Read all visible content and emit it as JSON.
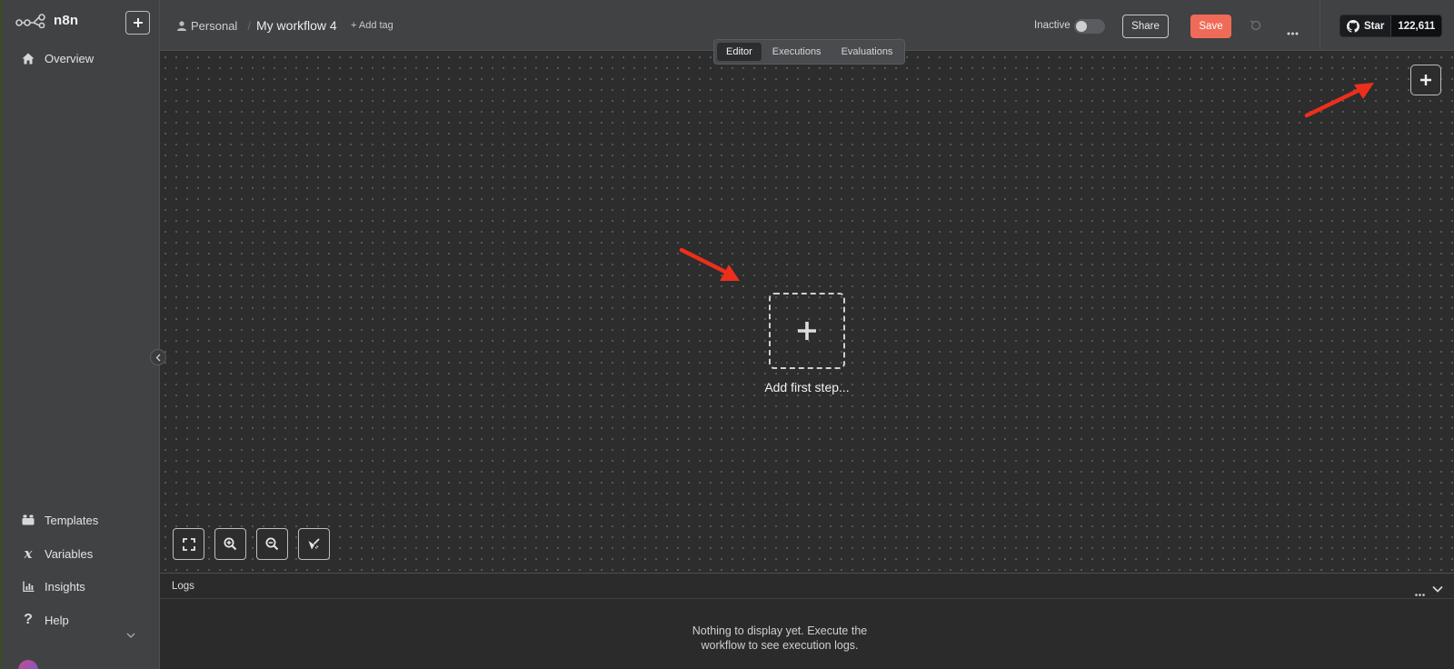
{
  "app": {
    "logo_text": "n8n",
    "accent_color": "#ef6b58"
  },
  "sidebar": {
    "top_items": [
      {
        "label": "Overview",
        "icon": "home-icon"
      }
    ],
    "bottom_items": [
      {
        "label": "Templates",
        "icon": "templates-icon"
      },
      {
        "label": "Variables",
        "icon": "variables-icon"
      },
      {
        "label": "Insights",
        "icon": "insights-icon"
      },
      {
        "label": "Help",
        "icon": "help-icon"
      }
    ]
  },
  "header": {
    "project": "Personal",
    "separator": "/",
    "workflow_name": "My workflow 4",
    "add_tag": "+ Add tag",
    "status_label": "Inactive",
    "share_label": "Share",
    "save_label": "Save",
    "github": {
      "star_label": "Star",
      "count": "122,611"
    }
  },
  "tabs": [
    {
      "label": "Editor",
      "active": true
    },
    {
      "label": "Executions",
      "active": false
    },
    {
      "label": "Evaluations",
      "active": false
    }
  ],
  "canvas": {
    "first_step_label": "Add first step..."
  },
  "logs": {
    "title": "Logs",
    "empty_message": "Nothing to display yet. Execute the workflow to see execution logs."
  }
}
